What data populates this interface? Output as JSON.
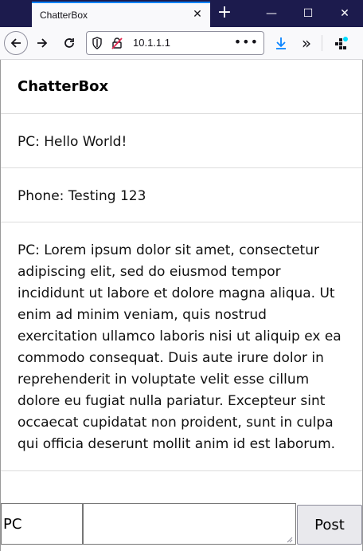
{
  "browser": {
    "tab_title": "ChatterBox",
    "tab_close_glyph": "✕",
    "new_tab_glyph": "+",
    "url": "10.1.1.1",
    "url_more_glyph": "•••",
    "window_min_glyph": "—",
    "window_max_glyph": "☐",
    "window_close_glyph": "✕",
    "overflow_glyph": "»",
    "colors": {
      "titlebar": "#1c1b4d",
      "tab_accent": "#0a84ff",
      "download_icon": "#0a84ff",
      "ext_dot": "#00ddff"
    }
  },
  "page": {
    "brand": "ChatterBox",
    "messages": [
      {
        "text": "PC: Hello World!"
      },
      {
        "text": "Phone: Testing 123"
      },
      {
        "text": "PC: Lorem ipsum dolor sit amet, consectetur adipiscing elit, sed do eiusmod tempor incididunt ut labore et dolore magna aliqua. Ut enim ad minim veniam, quis nostrud exercitation ullamco laboris nisi ut aliquip ex ea commodo consequat. Duis aute irure dolor in reprehenderit in voluptate velit esse cillum dolore eu fugiat nulla pariatur. Excepteur sint occaecat cupidatat non proident, sunt in culpa qui officia deserunt mollit anim id est laborum."
      }
    ],
    "form": {
      "name_value": "PC",
      "message_value": "",
      "post_label": "Post"
    }
  }
}
